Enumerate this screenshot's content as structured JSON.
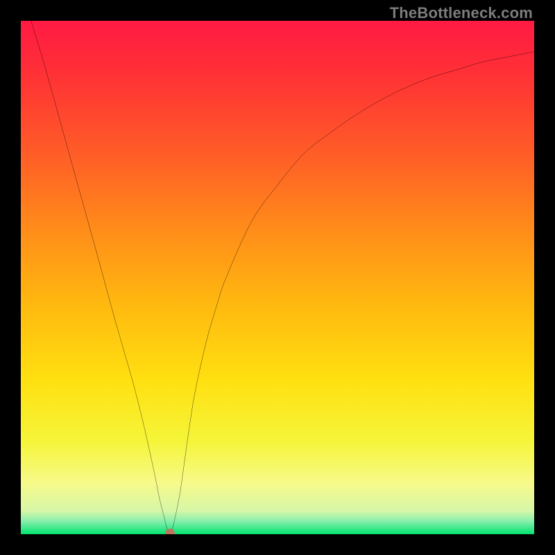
{
  "header": {
    "source_label": "TheBottleneck.com"
  },
  "colors": {
    "frame": "#000000",
    "title": "#7d7d7d",
    "curve": "#000000",
    "marker": "rgba(207,105,90,0.9)",
    "gradient_stops": [
      {
        "pos": 0.0,
        "color": "#ff1a44"
      },
      {
        "pos": 0.1,
        "color": "#ff3036"
      },
      {
        "pos": 0.25,
        "color": "#ff5a28"
      },
      {
        "pos": 0.4,
        "color": "#ff8a1a"
      },
      {
        "pos": 0.55,
        "color": "#ffb80f"
      },
      {
        "pos": 0.7,
        "color": "#ffe010"
      },
      {
        "pos": 0.82,
        "color": "#f5f53a"
      },
      {
        "pos": 0.9,
        "color": "#f7fa8a"
      },
      {
        "pos": 0.955,
        "color": "#d6f7a8"
      },
      {
        "pos": 0.975,
        "color": "#86efac"
      },
      {
        "pos": 1.0,
        "color": "#00e36e"
      }
    ]
  },
  "chart_data": {
    "type": "line",
    "title": "TheBottleneck.com",
    "xlabel": "",
    "ylabel": "",
    "xlim": [
      0,
      100
    ],
    "ylim": [
      0,
      100
    ],
    "series": [
      {
        "name": "bottleneck-curve",
        "x": [
          2,
          5,
          10,
          15,
          18,
          20,
          22,
          24,
          26,
          27,
          28,
          28.5,
          29,
          29.5,
          30,
          31,
          32,
          33,
          34,
          36,
          38,
          40,
          45,
          50,
          55,
          60,
          65,
          70,
          75,
          80,
          85,
          90,
          95,
          100
        ],
        "y": [
          100,
          90,
          72,
          54,
          43,
          36,
          29,
          21,
          12,
          7,
          3,
          1,
          0.2,
          1,
          3,
          8,
          15,
          22,
          28,
          37,
          44,
          50,
          61,
          68,
          74,
          78,
          81.5,
          84.5,
          87,
          89,
          90.5,
          92,
          93,
          94
        ]
      }
    ],
    "annotations": [
      {
        "name": "min-marker",
        "x": 29,
        "y": 0.2
      }
    ]
  }
}
